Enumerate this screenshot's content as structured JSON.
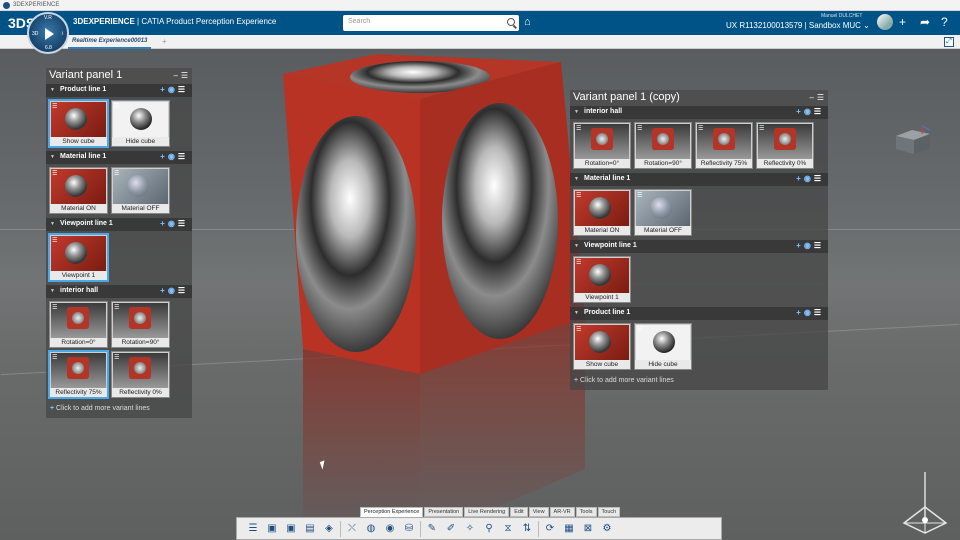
{
  "os": {
    "title": "3DEXPERIENCE"
  },
  "header": {
    "logo": "3DS",
    "compass": {
      "top": "V.R",
      "left": "3D",
      "right": "i",
      "bottom": "6.8"
    },
    "brand_bold": "3DEXPERIENCE",
    "brand_rest": " | CATIA  Product Perception Experience",
    "search_placeholder": "Search",
    "user": "Manuel DULCHET",
    "context": "UX R1132100013579 | Sandbox MUC ⌄"
  },
  "tabs": {
    "active": "Realtime Experience00013",
    "add": "+"
  },
  "panel_left": {
    "title": "Variant panel 1",
    "lines": [
      {
        "name": "Product line 1",
        "items": [
          {
            "label": "Show cube",
            "kind": "cube-red",
            "selected": true
          },
          {
            "label": "Hide cube",
            "kind": "sphere",
            "selected": false
          }
        ]
      },
      {
        "name": "Material line 1",
        "items": [
          {
            "label": "Material ON",
            "kind": "cube-red",
            "selected": false
          },
          {
            "label": "Material OFF",
            "kind": "grey",
            "selected": false
          }
        ]
      },
      {
        "name": "Viewpoint line 1",
        "items": [
          {
            "label": "Viewpoint 1",
            "kind": "cube-red",
            "selected": true
          }
        ]
      },
      {
        "name": "interior hall",
        "items": [
          {
            "label": "Rotation=0°",
            "kind": "hall",
            "selected": false
          },
          {
            "label": "Rotation=90°",
            "kind": "hall",
            "selected": false
          },
          {
            "label": "Reflectivity 75%",
            "kind": "hall",
            "selected": true
          },
          {
            "label": "Reflectivity 0%",
            "kind": "hall",
            "selected": false
          }
        ]
      }
    ],
    "add_more": "Click to add more variant lines"
  },
  "panel_right": {
    "title": "Variant panel 1 (copy)",
    "lines": [
      {
        "name": "interior hall",
        "items": [
          {
            "label": "Rotation=0°",
            "kind": "hall",
            "selected": false
          },
          {
            "label": "Rotation=90°",
            "kind": "hall",
            "selected": false
          },
          {
            "label": "Reflectivity 75%",
            "kind": "hall",
            "selected": false
          },
          {
            "label": "Reflectivity 0%",
            "kind": "hall",
            "selected": false
          }
        ]
      },
      {
        "name": "Material line 1",
        "items": [
          {
            "label": "Material ON",
            "kind": "cube-red",
            "selected": false
          },
          {
            "label": "Material OFF",
            "kind": "grey",
            "selected": false
          }
        ]
      },
      {
        "name": "Viewpoint line 1",
        "items": [
          {
            "label": "Viewpoint 1",
            "kind": "cube-red",
            "selected": false
          }
        ]
      },
      {
        "name": "Product line 1",
        "items": [
          {
            "label": "Show cube",
            "kind": "cube-red",
            "selected": false
          },
          {
            "label": "Hide cube",
            "kind": "sphere",
            "selected": false
          }
        ]
      }
    ],
    "add_more": "Click to add more variant lines"
  },
  "section_tabs": [
    "Perception Experience",
    "Presentation",
    "Live Rendering",
    "Edit",
    "View",
    "AR-VR",
    "Tools",
    "Touch"
  ],
  "active_section": "Perception Experience",
  "toolbar_icons": [
    "list-icon",
    "image-icon",
    "image-icon",
    "stamp-icon",
    "shapes-icon",
    "connector-icon",
    "globe-icon",
    "compass-icon",
    "cylinder-icon",
    "pencil-icon",
    "pen-icon",
    "drop-icon",
    "search-icon",
    "mirror-icon",
    "transfer-icon",
    "refresh-icon",
    "film-icon",
    "chart-icon",
    "gear-icon"
  ],
  "toolbar_glyphs": [
    "☰",
    "▣",
    "▣",
    "▤",
    "◈",
    "⤬",
    "◍",
    "◉",
    "⛁",
    "✎",
    "✐",
    "✧",
    "⚲",
    "⧖",
    "⇅",
    "⟳",
    "▦",
    "⊠",
    "⚙"
  ]
}
